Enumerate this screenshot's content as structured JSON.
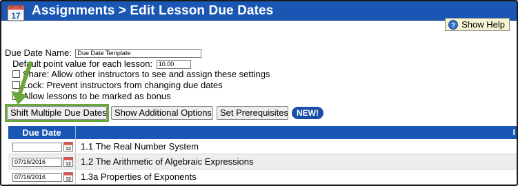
{
  "header": {
    "title": "Assignments > Edit Lesson Due Dates",
    "calendar_day": "17"
  },
  "help": {
    "label": "Show Help"
  },
  "form": {
    "due_date_name_label": "Due Date Name:",
    "due_date_name_value": "Due Date Template",
    "point_value_label": "Default point value for each lesson:",
    "point_value_value": "10.00",
    "share_label": "Share: Allow other instructors to see and assign these settings",
    "lock_label": "Lock: Prevent instructors from changing due dates",
    "bonus_label": "Allow lessons to be marked as bonus"
  },
  "toolbar": {
    "shift_label": "Shift Multiple Due Dates",
    "additional_label": "Show Additional Options",
    "prereq_label": "Set Prerequisites",
    "new_badge": "NEW!"
  },
  "table": {
    "header_due_date": "Due Date",
    "header_right": "I",
    "rows": [
      {
        "date": "",
        "lesson": "1.1 The Real Number System"
      },
      {
        "date": "07/16/2016",
        "lesson": "1.2 The Arithmetic of Algebraic Expressions"
      },
      {
        "date": "07/16/2016",
        "lesson": "1.3a Properties of Exponents"
      }
    ]
  },
  "colors": {
    "header_blue": "#1a57b4",
    "highlight_green": "#69a73b",
    "help_bg": "#f6f3d2"
  }
}
